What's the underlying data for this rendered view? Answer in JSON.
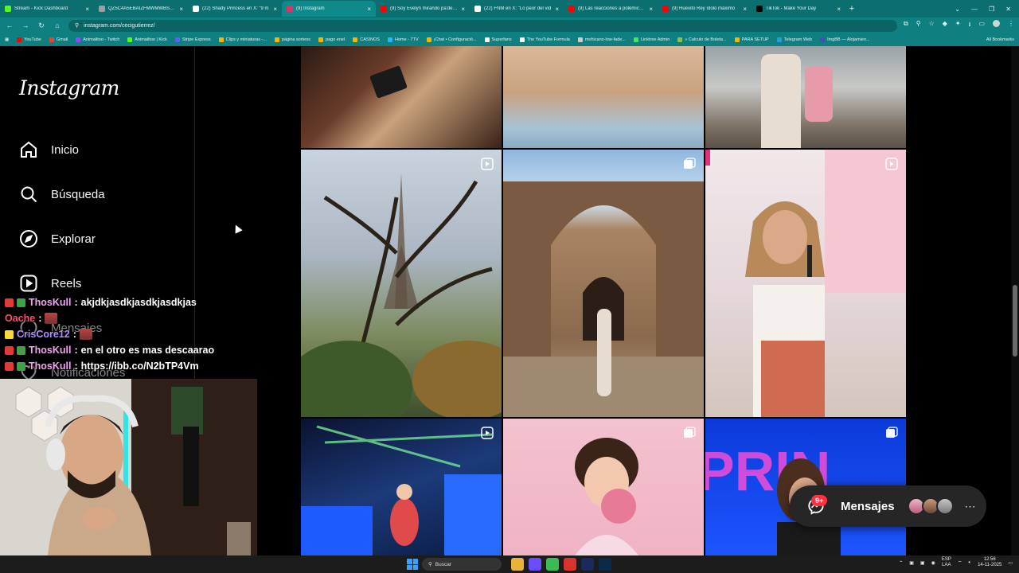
{
  "browser": {
    "tabs": [
      {
        "title": "Stream - Kick Dashboard",
        "color": "#53fc18"
      },
      {
        "title": "QZ5C4A5EBAIZFMWMWBSUN",
        "color": "#9aa0a6"
      },
      {
        "title": "(22) Shady Princess en X: \"9 m",
        "color": "#ffffff"
      },
      {
        "title": "(9) Instagram",
        "color": "#e1306c",
        "active": true
      },
      {
        "title": "(9) Soy Evelyn mirando pa'delan",
        "color": "#ff0000"
      },
      {
        "title": "(22) FNM en X: \"Lo peor del vid",
        "color": "#ffffff"
      },
      {
        "title": "(9) Las reacciones a polémico vi",
        "color": "#ff0000"
      },
      {
        "title": "(9) Huevito Rey ídolo máximo",
        "color": "#ff0000"
      },
      {
        "title": "TikTok - Make Your Day",
        "color": "#000000"
      }
    ],
    "url": "instagram.com/cecigutierrez/",
    "bookmarks": [
      "YouTube",
      "Gmail",
      "Animalitoo - Twitch",
      "Animalitoo | Kick",
      "Stripe Express",
      "Clips y miniaturas -...",
      "página sorteos",
      "pago enel",
      "CASINOS",
      "Home - 7TV",
      "¡Chat • Configuració...",
      "Superfans",
      "The YouTube Formula",
      "mohicano-low-fade...",
      "Linktree Admin",
      "» Calculo de Boleta...",
      "PARA SETUP",
      "Telegram Web",
      "ImgBB — Alojamien..."
    ],
    "all_bookmarks": "All Bookmarks"
  },
  "instagram": {
    "logo": "Instagram",
    "nav": [
      {
        "label": "Inicio",
        "icon": "home-icon"
      },
      {
        "label": "Búsqueda",
        "icon": "search-icon"
      },
      {
        "label": "Explorar",
        "icon": "compass-icon"
      },
      {
        "label": "Reels",
        "icon": "reels-icon"
      },
      {
        "label": "Mensajes",
        "icon": "messenger-icon"
      },
      {
        "label": "Notificaciones",
        "icon": "heart-icon"
      }
    ],
    "messages": {
      "label": "Mensajes",
      "count": "9+"
    }
  },
  "chat": [
    {
      "user": "ThosKull",
      "user_color": "#f4a3f4",
      "text": "akjdkjasdkjasdkjasdkjas"
    },
    {
      "user": "Oache",
      "user_color": "#ff4d6d",
      "text": ""
    },
    {
      "user": "CrisCore12",
      "user_color": "#b58cff",
      "text": ""
    },
    {
      "user": "ThosKull",
      "user_color": "#f4a3f4",
      "text": "en el otro es mas descaarao"
    },
    {
      "user": "ThosKull",
      "user_color": "#f4a3f4",
      "text": "https://ibb.co/N2bTP4Vm"
    }
  ],
  "taskbar": {
    "search": "Buscar",
    "lang": "ESP",
    "lang2": "LAA",
    "time": "12:56",
    "date": "14-11-2025"
  }
}
